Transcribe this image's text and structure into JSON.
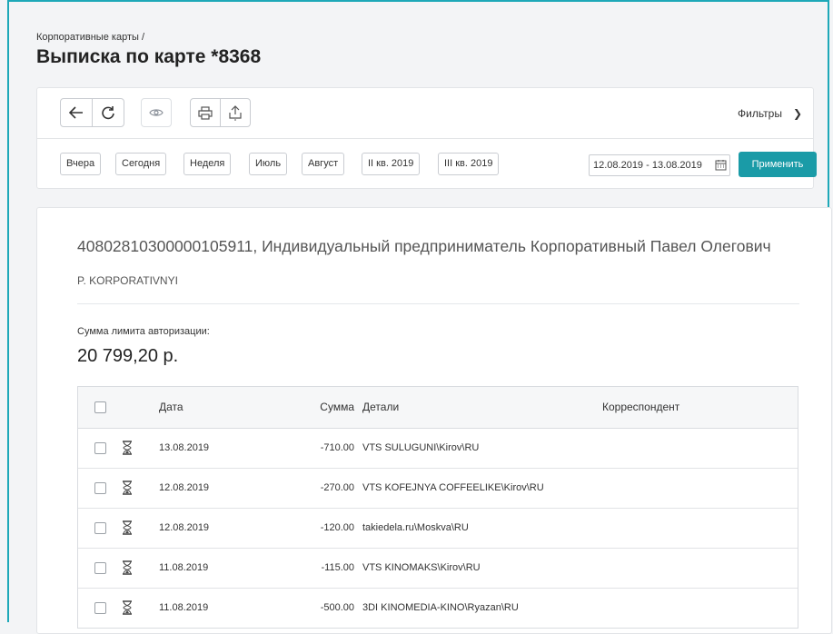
{
  "header": {
    "breadcrumb": "Корпоративные карты /",
    "title": "Выписка по карте *8368"
  },
  "toolbar": {
    "back_icon": "arrow-left-icon",
    "refresh_icon": "refresh-icon",
    "view_icon": "eye-icon",
    "print_icon": "print-icon",
    "export_icon": "upload-icon",
    "filters_label": "Фильтры",
    "filters_chevron": "❯",
    "periods": [
      "Вчера",
      "Сегодня",
      "Неделя",
      "Июль",
      "Август",
      "II кв. 2019",
      "III кв. 2019"
    ],
    "date_range": "12.08.2019 - 13.08.2019",
    "apply_label": "Применить"
  },
  "card": {
    "account_line": "40802810300000105911, Индивидуальный предприниматель Корпоративный Павел Олегович",
    "holder": "P. KORPORATIVNYI",
    "limit_label": "Сумма лимита авторизации:",
    "limit_value": "20 799,20 р."
  },
  "table": {
    "headers": {
      "date": "Дата",
      "sum": "Сумма",
      "details": "Детали",
      "correspondent": "Корреспондент"
    },
    "rows": [
      {
        "date": "13.08.2019",
        "sum": "-710.00",
        "details": "VTS SULUGUNI\\Kirov\\RU",
        "correspondent": ""
      },
      {
        "date": "12.08.2019",
        "sum": "-270.00",
        "details": "VTS KOFEJNYA COFFEELIKE\\Kirov\\RU",
        "correspondent": ""
      },
      {
        "date": "12.08.2019",
        "sum": "-120.00",
        "details": "takiedela.ru\\Moskva\\RU",
        "correspondent": ""
      },
      {
        "date": "11.08.2019",
        "sum": "-115.00",
        "details": "VTS KINOMAKS\\Kirov\\RU",
        "correspondent": ""
      },
      {
        "date": "11.08.2019",
        "sum": "-500.00",
        "details": "3DI KINOMEDIA-KINO\\Ryazan\\RU",
        "correspondent": ""
      }
    ]
  },
  "colors": {
    "accent": "#1a9ba7",
    "frame": "#1ea8b8"
  }
}
